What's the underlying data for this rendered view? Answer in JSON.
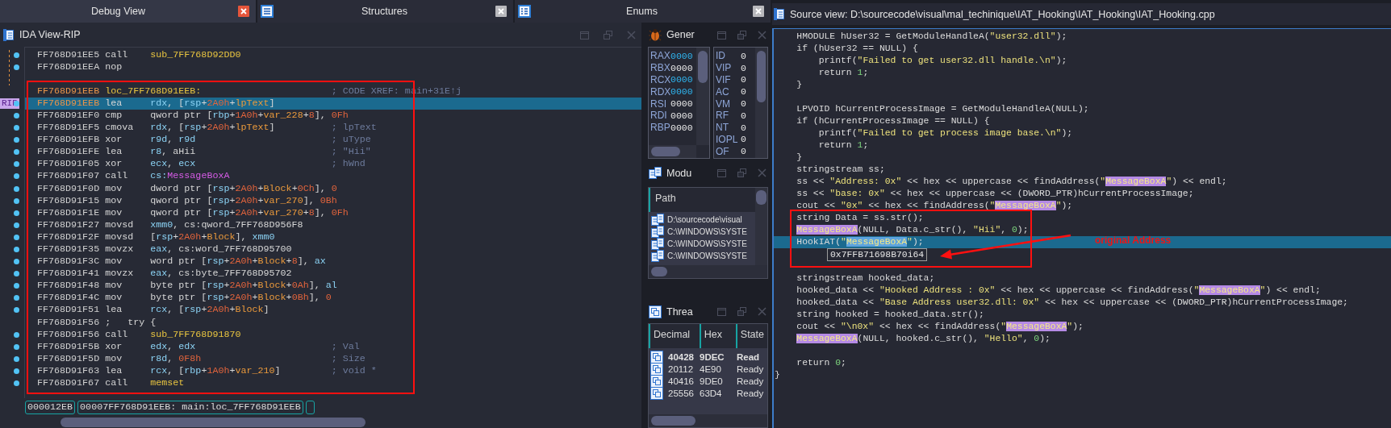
{
  "tabs": [
    {
      "label": "Debug View",
      "selected": true,
      "kind": "view"
    },
    {
      "label": "Structures",
      "selected": false,
      "kind": "struct"
    },
    {
      "label": "Enums",
      "selected": false,
      "kind": "enum"
    }
  ],
  "ida_view": {
    "title": "IDA View-RIP",
    "lines": [
      {
        "address": "FF768D91EE5",
        "kind": "insn",
        "mnemonic": "call",
        "operands": [
          {
            "text": "sub_7FF768D92DD0",
            "kind": "code"
          }
        ],
        "dot": true,
        "labeled": false,
        "selected": false
      },
      {
        "address": "FF768D91EEA",
        "kind": "insn",
        "mnemonic": "nop",
        "dot": true,
        "labeled": false,
        "selected": false
      },
      {
        "address": "FF768D91EEB",
        "kind": "label",
        "mnemonic": "loc_7FF768D91EEB:",
        "comment": "; CODE XREF: main+31E↑j",
        "dot": false,
        "labeled": true,
        "selected": false
      },
      {
        "address": "FF768D91EEB",
        "kind": "insn",
        "mnemonic": "lea",
        "operands": [
          {
            "text": "rdx",
            "kind": "reg"
          },
          {
            "text": ", [",
            "kind": "plain"
          },
          {
            "text": "rsp",
            "kind": "reg"
          },
          {
            "text": "+",
            "kind": "plain"
          },
          {
            "text": "2A0h",
            "kind": "num"
          },
          {
            "text": "+",
            "kind": "plain"
          },
          {
            "text": "lpText",
            "kind": "var"
          },
          {
            "text": "]",
            "kind": "plain"
          }
        ],
        "dot": true,
        "pointer": "RIP",
        "labeled": true,
        "selected": true
      },
      {
        "address": "FF768D91EF0",
        "kind": "insn",
        "mnemonic": "cmp",
        "operands": [
          {
            "text": "qword ptr [",
            "kind": "plain"
          },
          {
            "text": "rbp",
            "kind": "reg"
          },
          {
            "text": "+",
            "kind": "plain"
          },
          {
            "text": "1A0h",
            "kind": "num"
          },
          {
            "text": "+",
            "kind": "plain"
          },
          {
            "text": "var_228",
            "kind": "var"
          },
          {
            "text": "+",
            "kind": "plain"
          },
          {
            "text": "8",
            "kind": "num"
          },
          {
            "text": "], ",
            "kind": "plain"
          },
          {
            "text": "0Fh",
            "kind": "num"
          }
        ],
        "dot": true,
        "labeled": false,
        "selected": false
      },
      {
        "address": "FF768D91EF5",
        "kind": "insn",
        "mnemonic": "cmova",
        "operands": [
          {
            "text": "rdx",
            "kind": "reg"
          },
          {
            "text": ", [",
            "kind": "plain"
          },
          {
            "text": "rsp",
            "kind": "reg"
          },
          {
            "text": "+",
            "kind": "plain"
          },
          {
            "text": "2A0h",
            "kind": "num"
          },
          {
            "text": "+",
            "kind": "plain"
          },
          {
            "text": "lpText",
            "kind": "var"
          },
          {
            "text": "]",
            "kind": "plain"
          }
        ],
        "comment": "; lpText",
        "dot": true,
        "labeled": false,
        "selected": false
      },
      {
        "address": "FF768D91EFB",
        "kind": "insn",
        "mnemonic": "xor",
        "operands": [
          {
            "text": "r9d",
            "kind": "reg"
          },
          {
            "text": ", ",
            "kind": "plain"
          },
          {
            "text": "r9d",
            "kind": "reg"
          }
        ],
        "comment": "; uType",
        "dot": true,
        "labeled": false,
        "selected": false
      },
      {
        "address": "FF768D91EFE",
        "kind": "insn",
        "mnemonic": "lea",
        "operands": [
          {
            "text": "r8",
            "kind": "reg"
          },
          {
            "text": ", aHii",
            "kind": "plain"
          }
        ],
        "comment": "; \"Hii\"",
        "dot": true,
        "labeled": false,
        "selected": false
      },
      {
        "address": "FF768D91F05",
        "kind": "insn",
        "mnemonic": "xor",
        "operands": [
          {
            "text": "ecx",
            "kind": "reg"
          },
          {
            "text": ", ",
            "kind": "plain"
          },
          {
            "text": "ecx",
            "kind": "reg"
          }
        ],
        "comment": "; hWnd",
        "dot": true,
        "labeled": false,
        "selected": false
      },
      {
        "address": "FF768D91F07",
        "kind": "insn",
        "mnemonic": "call",
        "operands": [
          {
            "text": "cs:",
            "kind": "reg"
          },
          {
            "text": "MessageBoxA",
            "kind": "import"
          }
        ],
        "dot": true,
        "labeled": false,
        "selected": false
      },
      {
        "address": "FF768D91F0D",
        "kind": "insn",
        "mnemonic": "mov",
        "operands": [
          {
            "text": "dword ptr [",
            "kind": "plain"
          },
          {
            "text": "rsp",
            "kind": "reg"
          },
          {
            "text": "+",
            "kind": "plain"
          },
          {
            "text": "2A0h",
            "kind": "num"
          },
          {
            "text": "+",
            "kind": "plain"
          },
          {
            "text": "Block",
            "kind": "var"
          },
          {
            "text": "+",
            "kind": "plain"
          },
          {
            "text": "0Ch",
            "kind": "num"
          },
          {
            "text": "], ",
            "kind": "plain"
          },
          {
            "text": "0",
            "kind": "num"
          }
        ],
        "dot": true,
        "labeled": false,
        "selected": false
      },
      {
        "address": "FF768D91F15",
        "kind": "insn",
        "mnemonic": "mov",
        "operands": [
          {
            "text": "qword ptr [",
            "kind": "plain"
          },
          {
            "text": "rsp",
            "kind": "reg"
          },
          {
            "text": "+",
            "kind": "plain"
          },
          {
            "text": "2A0h",
            "kind": "num"
          },
          {
            "text": "+",
            "kind": "plain"
          },
          {
            "text": "var_270",
            "kind": "var"
          },
          {
            "text": "], ",
            "kind": "plain"
          },
          {
            "text": "0Bh",
            "kind": "num"
          }
        ],
        "dot": true,
        "labeled": false,
        "selected": false
      },
      {
        "address": "FF768D91F1E",
        "kind": "insn",
        "mnemonic": "mov",
        "operands": [
          {
            "text": "qword ptr [",
            "kind": "plain"
          },
          {
            "text": "rsp",
            "kind": "reg"
          },
          {
            "text": "+",
            "kind": "plain"
          },
          {
            "text": "2A0h",
            "kind": "num"
          },
          {
            "text": "+",
            "kind": "plain"
          },
          {
            "text": "var_270",
            "kind": "var"
          },
          {
            "text": "+",
            "kind": "plain"
          },
          {
            "text": "8",
            "kind": "num"
          },
          {
            "text": "], ",
            "kind": "plain"
          },
          {
            "text": "0Fh",
            "kind": "num"
          }
        ],
        "dot": true,
        "labeled": false,
        "selected": false
      },
      {
        "address": "FF768D91F27",
        "kind": "insn",
        "mnemonic": "movsd",
        "operands": [
          {
            "text": "xmm0",
            "kind": "reg"
          },
          {
            "text": ", cs:qword_7FF768D956F8",
            "kind": "plain"
          }
        ],
        "dot": true,
        "labeled": false,
        "selected": false
      },
      {
        "address": "FF768D91F2F",
        "kind": "insn",
        "mnemonic": "movsd",
        "operands": [
          {
            "text": "[",
            "kind": "plain"
          },
          {
            "text": "rsp",
            "kind": "reg"
          },
          {
            "text": "+",
            "kind": "plain"
          },
          {
            "text": "2A0h",
            "kind": "num"
          },
          {
            "text": "+",
            "kind": "plain"
          },
          {
            "text": "Block",
            "kind": "var"
          },
          {
            "text": "], ",
            "kind": "plain"
          },
          {
            "text": "xmm0",
            "kind": "reg"
          }
        ],
        "dot": true,
        "labeled": false,
        "selected": false
      },
      {
        "address": "FF768D91F35",
        "kind": "insn",
        "mnemonic": "movzx",
        "operands": [
          {
            "text": "eax",
            "kind": "reg"
          },
          {
            "text": ", cs:word_7FF768D95700",
            "kind": "plain"
          }
        ],
        "dot": true,
        "labeled": false,
        "selected": false
      },
      {
        "address": "FF768D91F3C",
        "kind": "insn",
        "mnemonic": "mov",
        "operands": [
          {
            "text": "word ptr [",
            "kind": "plain"
          },
          {
            "text": "rsp",
            "kind": "reg"
          },
          {
            "text": "+",
            "kind": "plain"
          },
          {
            "text": "2A0h",
            "kind": "num"
          },
          {
            "text": "+",
            "kind": "plain"
          },
          {
            "text": "Block",
            "kind": "var"
          },
          {
            "text": "+",
            "kind": "plain"
          },
          {
            "text": "8",
            "kind": "num"
          },
          {
            "text": "], ",
            "kind": "plain"
          },
          {
            "text": "ax",
            "kind": "reg"
          }
        ],
        "dot": true,
        "labeled": false,
        "selected": false
      },
      {
        "address": "FF768D91F41",
        "kind": "insn",
        "mnemonic": "movzx",
        "operands": [
          {
            "text": "eax",
            "kind": "reg"
          },
          {
            "text": ", cs:byte_7FF768D95702",
            "kind": "plain"
          }
        ],
        "dot": true,
        "labeled": false,
        "selected": false
      },
      {
        "address": "FF768D91F48",
        "kind": "insn",
        "mnemonic": "mov",
        "operands": [
          {
            "text": "byte ptr [",
            "kind": "plain"
          },
          {
            "text": "rsp",
            "kind": "reg"
          },
          {
            "text": "+",
            "kind": "plain"
          },
          {
            "text": "2A0h",
            "kind": "num"
          },
          {
            "text": "+",
            "kind": "plain"
          },
          {
            "text": "Block",
            "kind": "var"
          },
          {
            "text": "+",
            "kind": "plain"
          },
          {
            "text": "0Ah",
            "kind": "num"
          },
          {
            "text": "], ",
            "kind": "plain"
          },
          {
            "text": "al",
            "kind": "reg"
          }
        ],
        "dot": true,
        "labeled": false,
        "selected": false
      },
      {
        "address": "FF768D91F4C",
        "kind": "insn",
        "mnemonic": "mov",
        "operands": [
          {
            "text": "byte ptr [",
            "kind": "plain"
          },
          {
            "text": "rsp",
            "kind": "reg"
          },
          {
            "text": "+",
            "kind": "plain"
          },
          {
            "text": "2A0h",
            "kind": "num"
          },
          {
            "text": "+",
            "kind": "plain"
          },
          {
            "text": "Block",
            "kind": "var"
          },
          {
            "text": "+",
            "kind": "plain"
          },
          {
            "text": "0Bh",
            "kind": "num"
          },
          {
            "text": "], ",
            "kind": "plain"
          },
          {
            "text": "0",
            "kind": "num"
          }
        ],
        "dot": true,
        "labeled": false,
        "selected": false
      },
      {
        "address": "FF768D91F51",
        "kind": "insn",
        "mnemonic": "lea",
        "operands": [
          {
            "text": "rcx",
            "kind": "reg"
          },
          {
            "text": ", [",
            "kind": "plain"
          },
          {
            "text": "rsp",
            "kind": "reg"
          },
          {
            "text": "+",
            "kind": "plain"
          },
          {
            "text": "2A0h",
            "kind": "num"
          },
          {
            "text": "+",
            "kind": "plain"
          },
          {
            "text": "Block",
            "kind": "var"
          },
          {
            "text": "]",
            "kind": "plain"
          }
        ],
        "dot": true,
        "labeled": false,
        "selected": false
      },
      {
        "address": "FF768D91F56",
        "kind": "remark",
        "mnemonic": ";   try {",
        "dot": false,
        "labeled": false,
        "selected": false
      },
      {
        "address": "FF768D91F56",
        "kind": "insn",
        "mnemonic": "call",
        "operands": [
          {
            "text": "sub_7FF768D91870",
            "kind": "code"
          }
        ],
        "dot": true,
        "labeled": false,
        "selected": false
      },
      {
        "address": "FF768D91F5B",
        "kind": "insn",
        "mnemonic": "xor",
        "operands": [
          {
            "text": "edx",
            "kind": "reg"
          },
          {
            "text": ", ",
            "kind": "plain"
          },
          {
            "text": "edx",
            "kind": "reg"
          }
        ],
        "comment": "; Val",
        "dot": true,
        "labeled": false,
        "selected": false
      },
      {
        "address": "FF768D91F5D",
        "kind": "insn",
        "mnemonic": "mov",
        "operands": [
          {
            "text": "r8d",
            "kind": "reg"
          },
          {
            "text": ", ",
            "kind": "plain"
          },
          {
            "text": "0F8h",
            "kind": "num"
          }
        ],
        "comment": "; Size",
        "dot": true,
        "labeled": false,
        "selected": false
      },
      {
        "address": "FF768D91F63",
        "kind": "insn",
        "mnemonic": "lea",
        "operands": [
          {
            "text": "rcx",
            "kind": "reg"
          },
          {
            "text": ", [",
            "kind": "plain"
          },
          {
            "text": "rbp",
            "kind": "reg"
          },
          {
            "text": "+",
            "kind": "plain"
          },
          {
            "text": "1A0h",
            "kind": "num"
          },
          {
            "text": "+",
            "kind": "plain"
          },
          {
            "text": "var_210",
            "kind": "var"
          },
          {
            "text": "]",
            "kind": "plain"
          }
        ],
        "comment": "; void *",
        "dot": true,
        "labeled": false,
        "selected": false
      },
      {
        "address": "FF768D91F67",
        "kind": "insn",
        "mnemonic": "call",
        "operands": [
          {
            "text": "memset",
            "kind": "code"
          }
        ],
        "dot": true,
        "labeled": false,
        "selected": false
      }
    ],
    "status": [
      "000012EB",
      "00007FF768D91EEB: main:loc_7FF768D91EEB"
    ]
  },
  "registers": {
    "title": "Gener",
    "general": [
      {
        "name": "RAX",
        "value": "0000",
        "changed": true
      },
      {
        "name": "RBX",
        "value": "0000",
        "changed": false
      },
      {
        "name": "RCX",
        "value": "0000",
        "changed": true
      },
      {
        "name": "RDX",
        "value": "0000",
        "changed": true
      },
      {
        "name": "RSI",
        "value": "0000",
        "changed": false
      },
      {
        "name": "RDI",
        "value": "0000",
        "changed": false
      },
      {
        "name": "RBP",
        "value": "0000",
        "changed": false
      }
    ],
    "flags": [
      {
        "name": "ID",
        "value": "0"
      },
      {
        "name": "VIP",
        "value": "0"
      },
      {
        "name": "VIF",
        "value": "0"
      },
      {
        "name": "AC",
        "value": "0"
      },
      {
        "name": "VM",
        "value": "0"
      },
      {
        "name": "RF",
        "value": "0"
      },
      {
        "name": "NT",
        "value": "0"
      },
      {
        "name": "IOPL",
        "value": "0"
      },
      {
        "name": "OF",
        "value": "0"
      }
    ]
  },
  "modules": {
    "title": "Modu",
    "column": "Path",
    "rows": [
      "D:\\sourcecode\\visual",
      "C:\\WINDOWS\\SYSTE",
      "C:\\WINDOWS\\SYSTE",
      "C:\\WINDOWS\\SYSTE"
    ]
  },
  "threads": {
    "title": "Threa",
    "columns": [
      "Decimal",
      "Hex",
      "State"
    ],
    "rows": [
      {
        "cells": [
          "40428",
          "9DEC",
          "Read"
        ],
        "current": true
      },
      {
        "cells": [
          "20112",
          "4E90",
          "Ready"
        ],
        "current": false
      },
      {
        "cells": [
          "40416",
          "9DE0",
          "Ready"
        ],
        "current": false
      },
      {
        "cells": [
          "25556",
          "63D4",
          "Ready"
        ],
        "current": false
      }
    ]
  },
  "source_view": {
    "title": "Source view: D:\\sourcecode\\visual\\mal_techinique\\IAT_Hooking\\IAT_Hooking\\IAT_Hooking.cpp",
    "lines": [
      {
        "selected": false,
        "tokens": [
          {
            "text": "    HMODULE hUser32 = GetModuleHandleA(",
            "kind": "plain"
          },
          {
            "text": "\"user32.dll\"",
            "kind": "str"
          },
          {
            "text": ");",
            "kind": "plain"
          }
        ]
      },
      {
        "selected": false,
        "tokens": [
          {
            "text": "    if (hUser32 == NULL) {",
            "kind": "plain"
          }
        ]
      },
      {
        "selected": false,
        "tokens": [
          {
            "text": "        printf(",
            "kind": "plain"
          },
          {
            "text": "\"Failed to get user32.dll handle.\\n\"",
            "kind": "str"
          },
          {
            "text": ");",
            "kind": "plain"
          }
        ]
      },
      {
        "selected": false,
        "tokens": [
          {
            "text": "        return ",
            "kind": "plain"
          },
          {
            "text": "1",
            "kind": "num"
          },
          {
            "text": ";",
            "kind": "plain"
          }
        ]
      },
      {
        "selected": false,
        "tokens": [
          {
            "text": "    }",
            "kind": "plain"
          }
        ]
      },
      {
        "selected": false
      },
      {
        "selected": false,
        "tokens": [
          {
            "text": "    LPVOID hCurrentProcessImage = GetModuleHandleA(NULL);",
            "kind": "plain"
          }
        ]
      },
      {
        "selected": false,
        "tokens": [
          {
            "text": "    if (hCurrentProcessImage == NULL) {",
            "kind": "plain"
          }
        ]
      },
      {
        "selected": false,
        "tokens": [
          {
            "text": "        printf(",
            "kind": "plain"
          },
          {
            "text": "\"Failed to get process image base.\\n\"",
            "kind": "str"
          },
          {
            "text": ");",
            "kind": "plain"
          }
        ]
      },
      {
        "selected": false,
        "tokens": [
          {
            "text": "        return ",
            "kind": "plain"
          },
          {
            "text": "1",
            "kind": "num"
          },
          {
            "text": ";",
            "kind": "plain"
          }
        ]
      },
      {
        "selected": false,
        "tokens": [
          {
            "text": "    }",
            "kind": "plain"
          }
        ]
      },
      {
        "selected": false,
        "tokens": [
          {
            "text": "    stringstream ss;",
            "kind": "plain"
          }
        ]
      },
      {
        "selected": false,
        "tokens": [
          {
            "text": "    ss << ",
            "kind": "plain"
          },
          {
            "text": "\"Address: 0x\"",
            "kind": "str"
          },
          {
            "text": " << hex << uppercase << findAddress(",
            "kind": "plain"
          },
          {
            "text": "\"",
            "kind": "str"
          },
          {
            "text": "MessageBoxA",
            "kind": "match"
          },
          {
            "text": "\"",
            "kind": "str"
          },
          {
            "text": ") << endl;",
            "kind": "plain"
          }
        ]
      },
      {
        "selected": false,
        "tokens": [
          {
            "text": "    ss << ",
            "kind": "plain"
          },
          {
            "text": "\"base: 0x\"",
            "kind": "str"
          },
          {
            "text": " << hex << uppercase << (DWORD_PTR)hCurrentProcessImage;",
            "kind": "plain"
          }
        ]
      },
      {
        "selected": false,
        "tokens": [
          {
            "text": "    cout << ",
            "kind": "plain"
          },
          {
            "text": "\"0x\"",
            "kind": "str"
          },
          {
            "text": " << hex << findAddress(",
            "kind": "plain"
          },
          {
            "text": "\"",
            "kind": "str"
          },
          {
            "text": "MessageBoxA",
            "kind": "match"
          },
          {
            "text": "\"",
            "kind": "str"
          },
          {
            "text": ");",
            "kind": "plain"
          }
        ]
      },
      {
        "selected": false,
        "tokens": [
          {
            "text": "    string Data = ss.str();",
            "kind": "plain"
          }
        ]
      },
      {
        "selected": false,
        "tokens": [
          {
            "text": "    MessageBoxA",
            "kind": "match"
          },
          {
            "text": "(NULL, Data.c_str(), ",
            "kind": "plain"
          },
          {
            "text": "\"Hii\"",
            "kind": "str"
          },
          {
            "text": ", ",
            "kind": "plain"
          },
          {
            "text": "0",
            "kind": "num"
          },
          {
            "text": ");",
            "kind": "plain"
          }
        ]
      },
      {
        "selected": true,
        "tokens": [
          {
            "text": "    HookIAT(",
            "kind": "plain"
          },
          {
            "text": "\"",
            "kind": "str"
          },
          {
            "text": "MessageBoxA",
            "kind": "match"
          },
          {
            "text": "\"",
            "kind": "str"
          },
          {
            "text": ");",
            "kind": "plain"
          }
        ]
      },
      {
        "selected": false
      },
      {
        "selected": false
      },
      {
        "selected": false,
        "tokens": [
          {
            "text": "    stringstream hooked_data;",
            "kind": "plain"
          }
        ]
      },
      {
        "selected": false,
        "tokens": [
          {
            "text": "    hooked_data << ",
            "kind": "plain"
          },
          {
            "text": "\"Hooked Address : 0x\"",
            "kind": "str"
          },
          {
            "text": " << hex << uppercase << findAddress(",
            "kind": "plain"
          },
          {
            "text": "\"",
            "kind": "str"
          },
          {
            "text": "MessageBoxA",
            "kind": "match"
          },
          {
            "text": "\"",
            "kind": "str"
          },
          {
            "text": ") << endl;",
            "kind": "plain"
          }
        ]
      },
      {
        "selected": false,
        "tokens": [
          {
            "text": "    hooked_data << ",
            "kind": "plain"
          },
          {
            "text": "\"Base Address user32.dll: 0x\"",
            "kind": "str"
          },
          {
            "text": " << hex << uppercase << (DWORD_PTR)hCurrentProcessImage;",
            "kind": "plain"
          }
        ]
      },
      {
        "selected": false,
        "tokens": [
          {
            "text": "    string hooked = hooked_data.str();",
            "kind": "plain"
          }
        ]
      },
      {
        "selected": false,
        "tokens": [
          {
            "text": "    cout << ",
            "kind": "plain"
          },
          {
            "text": "\"\\n0x\"",
            "kind": "str"
          },
          {
            "text": " << hex << findAddress(",
            "kind": "plain"
          },
          {
            "text": "\"",
            "kind": "str"
          },
          {
            "text": "MessageBoxA",
            "kind": "match"
          },
          {
            "text": "\"",
            "kind": "str"
          },
          {
            "text": ");",
            "kind": "plain"
          }
        ]
      },
      {
        "selected": false,
        "tokens": [
          {
            "text": "    MessageBoxA",
            "kind": "match"
          },
          {
            "text": "(NULL, hooked.c_str(), ",
            "kind": "plain"
          },
          {
            "text": "\"Hello\"",
            "kind": "str"
          },
          {
            "text": ", ",
            "kind": "plain"
          },
          {
            "text": "0",
            "kind": "num"
          },
          {
            "text": ");",
            "kind": "plain"
          }
        ]
      },
      {
        "selected": false
      },
      {
        "selected": false,
        "tokens": [
          {
            "text": "    return ",
            "kind": "plain"
          },
          {
            "text": "0",
            "kind": "num"
          },
          {
            "text": ";",
            "kind": "plain"
          }
        ]
      },
      {
        "selected": false,
        "tokens": [
          {
            "text": "}",
            "kind": "plain"
          }
        ]
      }
    ],
    "hover_value": "0x7FFB71698B70i64",
    "annotation": {
      "label": "original Address"
    }
  }
}
